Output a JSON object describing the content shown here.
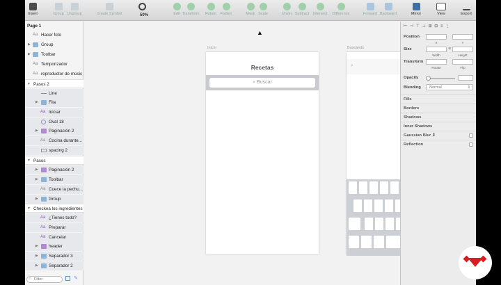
{
  "toolbar": {
    "insert": "Insert",
    "group": "Group",
    "ungroup": "Ungroup",
    "create_symbol": "Create Symbol",
    "zoom_value": "50%",
    "edit": "Edit",
    "transform": "Transform",
    "rotate": "Rotate",
    "flatten": "Flatten",
    "mask": "Mask",
    "scale": "Scale",
    "union": "Union",
    "subtract": "Subtract",
    "intersect": "Intersect",
    "difference": "Difference",
    "forward": "Forward",
    "backward": "Backward",
    "mirror": "Mirror",
    "view": "View",
    "export": "Export"
  },
  "sidebar": {
    "page": "Page 1",
    "layers": [
      "Hacer foto",
      "Group",
      "Toolbar",
      "Temporizador",
      "reproductor de músic",
      "Pasos 2",
      "Line",
      "Fila",
      "Iniciar",
      "Oval 18",
      "Paginación 2",
      "Cocina durante...",
      "spacing 2",
      "Pasos",
      "Paginación 2",
      "Toolbar",
      "Cuece la pechu...",
      "Group",
      "Checkea los ingredientes",
      "¿Tienes todo?",
      "Preparar",
      "Cancelar",
      "header",
      "Separador 3",
      "Separador 2"
    ],
    "filter_placeholder": "Filter"
  },
  "canvas": {
    "artboard1_label": "Inicio",
    "artboard2_label": "Buscando",
    "screen_title": "Recetas",
    "search_placeholder": "Buscar"
  },
  "inspector": {
    "position": "Position",
    "x": "X",
    "y": "Y",
    "size": "Size",
    "width": "Width",
    "height": "Height",
    "transform": "Transform",
    "rotate": "Rotate",
    "flip": "Flip",
    "opacity": "Opacity",
    "blending": "Blending",
    "blending_value": "Normal",
    "fills": "Fills",
    "borders": "Borders",
    "shadows": "Shadows",
    "inner_shadows": "Inner Shadows",
    "gaussian_blur": "Gaussian Blur ⇕",
    "reflection": "Reflection"
  }
}
